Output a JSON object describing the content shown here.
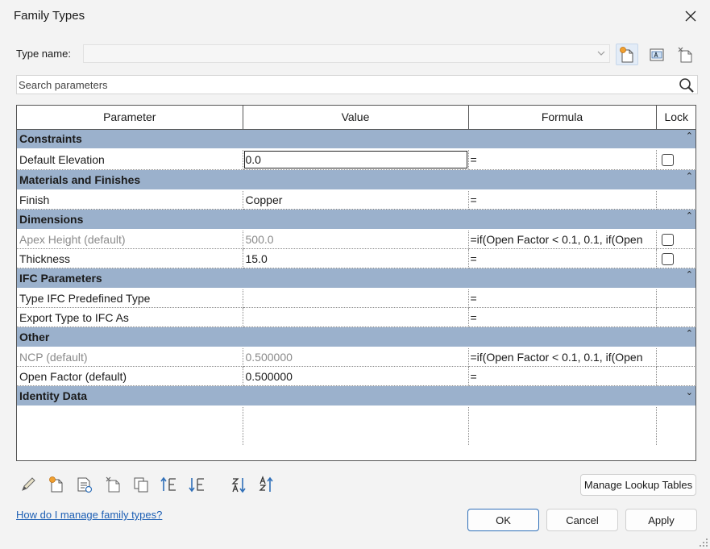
{
  "window": {
    "title": "Family Types"
  },
  "type_name": {
    "label": "Type name:",
    "value": ""
  },
  "search": {
    "placeholder": "Search parameters"
  },
  "table": {
    "headers": {
      "parameter": "Parameter",
      "value": "Value",
      "formula": "Formula",
      "lock": "Lock"
    },
    "groups": {
      "constraints": {
        "title": "Constraints",
        "rows": [
          {
            "parameter": "Default Elevation",
            "value": "0.0",
            "formula": "="
          }
        ]
      },
      "materials": {
        "title": "Materials and Finishes",
        "rows": [
          {
            "parameter": "Finish",
            "value": "Copper",
            "formula": "="
          }
        ]
      },
      "dimensions": {
        "title": "Dimensions",
        "rows": [
          {
            "parameter": "Apex Height (default)",
            "value": "500.0",
            "formula": "=if(Open Factor < 0.1, 0.1, if(Open"
          },
          {
            "parameter": "Thickness",
            "value": "15.0",
            "formula": "="
          }
        ]
      },
      "ifc": {
        "title": "IFC Parameters",
        "rows": [
          {
            "parameter": "Type IFC Predefined Type",
            "value": "",
            "formula": "="
          },
          {
            "parameter": "Export Type to IFC As",
            "value": "",
            "formula": "="
          }
        ]
      },
      "other": {
        "title": "Other",
        "rows": [
          {
            "parameter": "NCP (default)",
            "value": "0.500000",
            "formula": "=if(Open Factor < 0.1, 0.1, if(Open"
          },
          {
            "parameter": "Open Factor (default)",
            "value": "0.500000",
            "formula": "="
          }
        ]
      },
      "identity": {
        "title": "Identity Data"
      }
    }
  },
  "buttons": {
    "manage_lookup": "Manage Lookup Tables",
    "ok": "OK",
    "cancel": "Cancel",
    "apply": "Apply"
  },
  "help_link": "How do I manage family types?",
  "icons": {
    "close": "close-icon",
    "new_type": "new-type-icon",
    "rename_type": "rename-type-icon",
    "delete_type": "delete-type-icon",
    "search": "search-icon",
    "edit_parameter": "pencil-icon",
    "new_parameter": "new-parameter-icon",
    "shared_parameter": "shared-parameter-icon",
    "delete_parameter": "delete-parameter-icon",
    "copy": "copy-icon",
    "move_up": "move-up-icon",
    "move_down": "move-down-icon",
    "sort_ascending": "sort-ascending-icon",
    "sort_descending": "sort-descending-icon"
  },
  "colors": {
    "group_header": "#9bb1cc",
    "link": "#1d5fb4",
    "primary_border": "#2f6fb8"
  }
}
